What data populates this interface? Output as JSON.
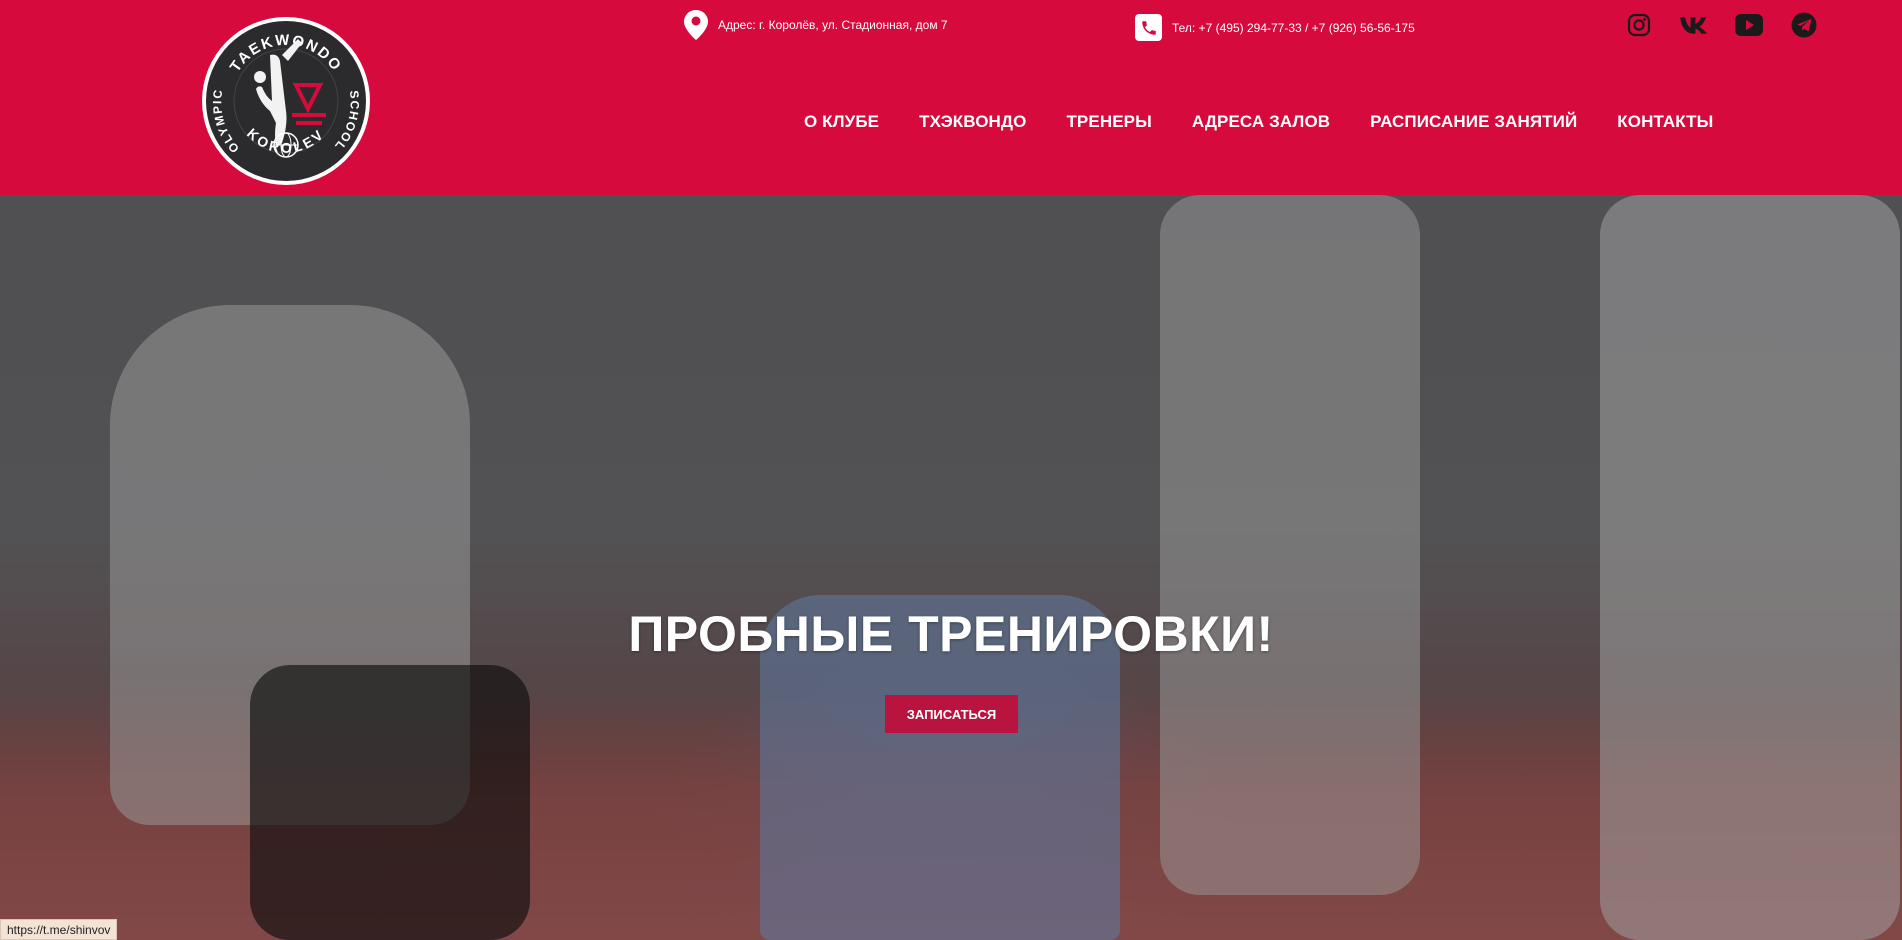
{
  "header": {
    "background_color": "#d70a3d",
    "logo": {
      "text_top": "TAEKWONDO",
      "text_left": "OLYMPIC",
      "text_right": "SCHOOL",
      "text_bottom": "KOROLEV"
    },
    "address": {
      "icon": "map-pin-icon",
      "text": "Адрес: г. Королёв, ул. Стадионная, дом 7"
    },
    "phone": {
      "icon": "phone-icon",
      "text": "Тел: +7 (495) 294-77-33 / +7 (926) 56-56-175"
    },
    "socials": [
      {
        "name": "instagram-icon"
      },
      {
        "name": "vk-icon"
      },
      {
        "name": "youtube-icon"
      },
      {
        "name": "telegram-icon"
      }
    ],
    "nav": [
      {
        "label": "О КЛУБЕ"
      },
      {
        "label": "ТХЭКВОНДО"
      },
      {
        "label": "ТРЕНЕРЫ"
      },
      {
        "label": "АДРЕСА ЗАЛОВ"
      },
      {
        "label": "РАСПИСАНИЕ ЗАНЯТИЙ"
      },
      {
        "label": "КОНТАКТЫ"
      }
    ]
  },
  "hero": {
    "title": "ПРОБНЫЕ ТРЕНИРОВКИ!",
    "cta_label": "ЗАПИСАТЬСЯ",
    "cta_color": "#b8143f"
  },
  "status_bar": {
    "url": "https://t.me/shinvov"
  }
}
